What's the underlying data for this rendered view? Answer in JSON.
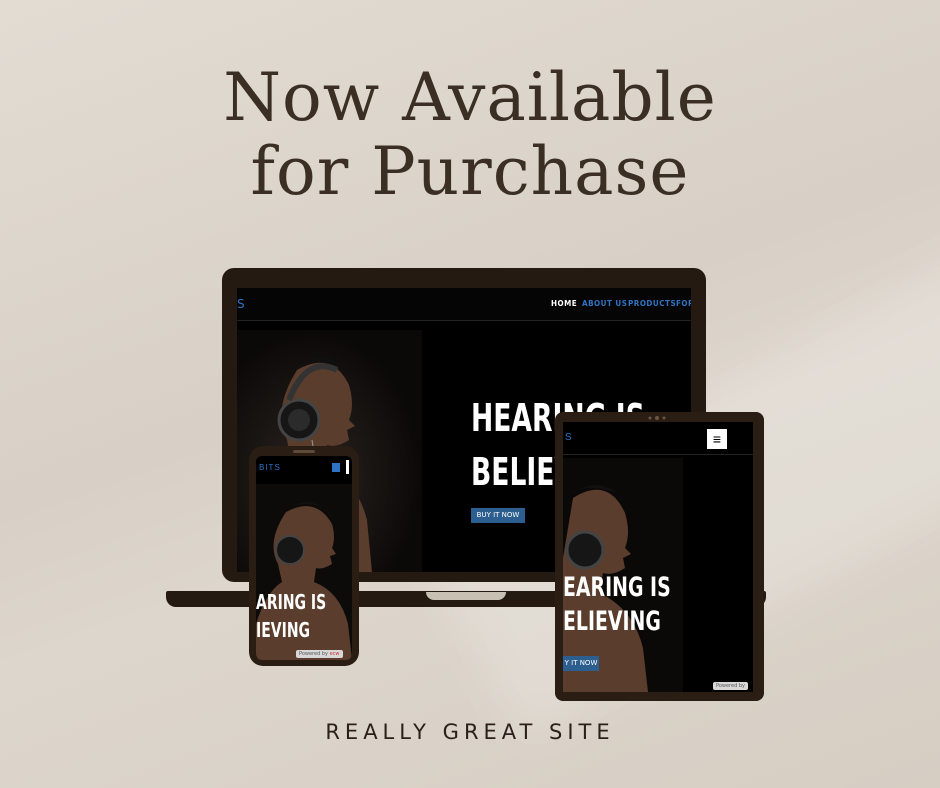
{
  "headline": {
    "line1": "Now Available",
    "line2": "for Purchase"
  },
  "footer": "REALLY GREAT SITE",
  "laptop": {
    "brand_fragment": "S",
    "nav": [
      "HOME",
      "ABOUT US",
      "PRODUCTS",
      "FOR"
    ],
    "hero_line1": "HEARING IS",
    "hero_line2": "BELIEV",
    "cta": "BUY IT NOW"
  },
  "phone": {
    "brand_fragment": "BITS",
    "hero_line1": "ARING IS",
    "hero_line2": "IEVING",
    "powered": "Powered by",
    "powered_brand": "ecw"
  },
  "tablet": {
    "brand_fragment": "S",
    "menu_icon": "≡",
    "hero_line1": "EARING IS",
    "hero_line2": "ELIEVING",
    "cta": "Y IT NOW",
    "powered": "Powered by"
  },
  "colors": {
    "background": "#ddd6cc",
    "text": "#3b2f25",
    "device": "#241a12",
    "accent": "#2f74c4",
    "button": "#2c5e8f"
  }
}
